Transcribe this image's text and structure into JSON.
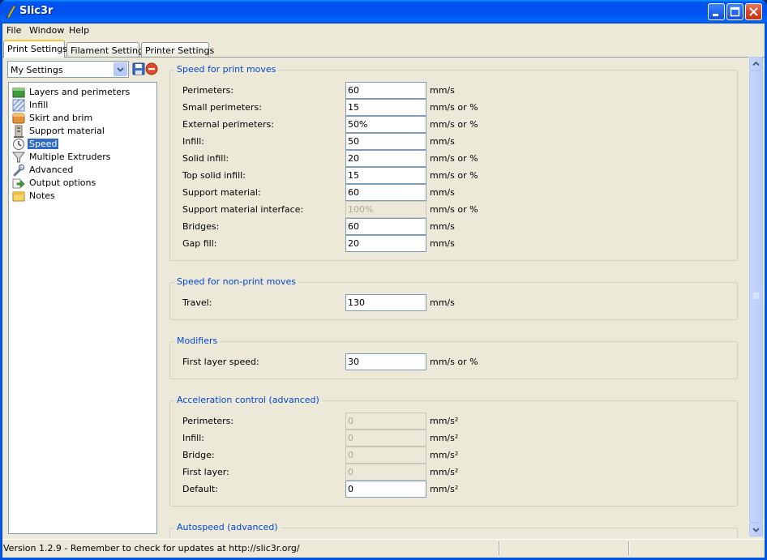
{
  "window": {
    "title": "Slic3r"
  },
  "menu": [
    "File",
    "Window",
    "Help"
  ],
  "tabs": [
    "Print Settings",
    "Filament Settings",
    "Printer Settings"
  ],
  "preset": {
    "selected": "My Settings"
  },
  "tree": {
    "items": [
      {
        "label": "Layers and perimeters",
        "icon": "layers-icon"
      },
      {
        "label": "Infill",
        "icon": "infill-icon"
      },
      {
        "label": "Skirt and brim",
        "icon": "box-icon"
      },
      {
        "label": "Support material",
        "icon": "building-icon"
      },
      {
        "label": "Speed",
        "icon": "clock-icon"
      },
      {
        "label": "Multiple Extruders",
        "icon": "funnel-icon"
      },
      {
        "label": "Advanced",
        "icon": "wrench-icon"
      },
      {
        "label": "Output options",
        "icon": "output-arrow-icon"
      },
      {
        "label": "Notes",
        "icon": "note-icon"
      }
    ],
    "selected": "Speed"
  },
  "groups": [
    {
      "title": "Speed for print moves",
      "rows": [
        {
          "label": "Perimeters:",
          "value": "60",
          "unit": "mm/s",
          "disabled": false
        },
        {
          "label": "Small perimeters:",
          "value": "15",
          "unit": "mm/s or %",
          "disabled": false
        },
        {
          "label": "External perimeters:",
          "value": "50%",
          "unit": "mm/s or %",
          "disabled": false
        },
        {
          "label": "Infill:",
          "value": "50",
          "unit": "mm/s",
          "disabled": false
        },
        {
          "label": "Solid infill:",
          "value": "20",
          "unit": "mm/s or %",
          "disabled": false
        },
        {
          "label": "Top solid infill:",
          "value": "15",
          "unit": "mm/s or %",
          "disabled": false
        },
        {
          "label": "Support material:",
          "value": "60",
          "unit": "mm/s",
          "disabled": false
        },
        {
          "label": "Support material interface:",
          "value": "100%",
          "unit": "mm/s or %",
          "disabled": true
        },
        {
          "label": "Bridges:",
          "value": "60",
          "unit": "mm/s",
          "disabled": false
        },
        {
          "label": "Gap fill:",
          "value": "20",
          "unit": "mm/s",
          "disabled": false
        }
      ]
    },
    {
      "title": "Speed for non-print moves",
      "rows": [
        {
          "label": "Travel:",
          "value": "130",
          "unit": "mm/s",
          "disabled": false
        }
      ]
    },
    {
      "title": "Modifiers",
      "rows": [
        {
          "label": "First layer speed:",
          "value": "30",
          "unit": "mm/s or %",
          "disabled": false
        }
      ]
    },
    {
      "title": "Acceleration control (advanced)",
      "rows": [
        {
          "label": "Perimeters:",
          "value": "0",
          "unit": "mm/s²",
          "disabled": true
        },
        {
          "label": "Infill:",
          "value": "0",
          "unit": "mm/s²",
          "disabled": true
        },
        {
          "label": "Bridge:",
          "value": "0",
          "unit": "mm/s²",
          "disabled": true
        },
        {
          "label": "First layer:",
          "value": "0",
          "unit": "mm/s²",
          "disabled": true
        },
        {
          "label": "Default:",
          "value": "0",
          "unit": "mm/s²",
          "disabled": false
        }
      ]
    },
    {
      "title": "Autospeed (advanced)",
      "rows": []
    }
  ],
  "status": {
    "text": "Version 1.2.9 - Remember to check for updates at http://slic3r.org/"
  }
}
